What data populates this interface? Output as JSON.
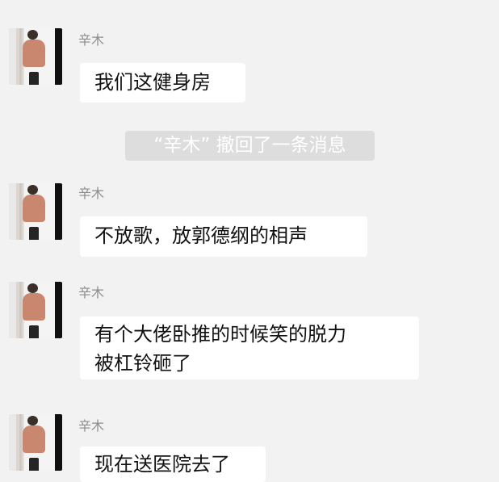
{
  "messages": [
    {
      "sender": "辛木",
      "text": "我们这健身房"
    },
    {
      "sender": "辛木",
      "text": "不放歌，放郭德纲的相声"
    },
    {
      "sender": "辛木",
      "text": "有个大佬卧推的时候笑的脱力\n被杠铃砸了"
    },
    {
      "sender": "辛木",
      "text": "现在送医院去了"
    }
  ],
  "system_notice": "“辛木” 撤回了一条消息"
}
